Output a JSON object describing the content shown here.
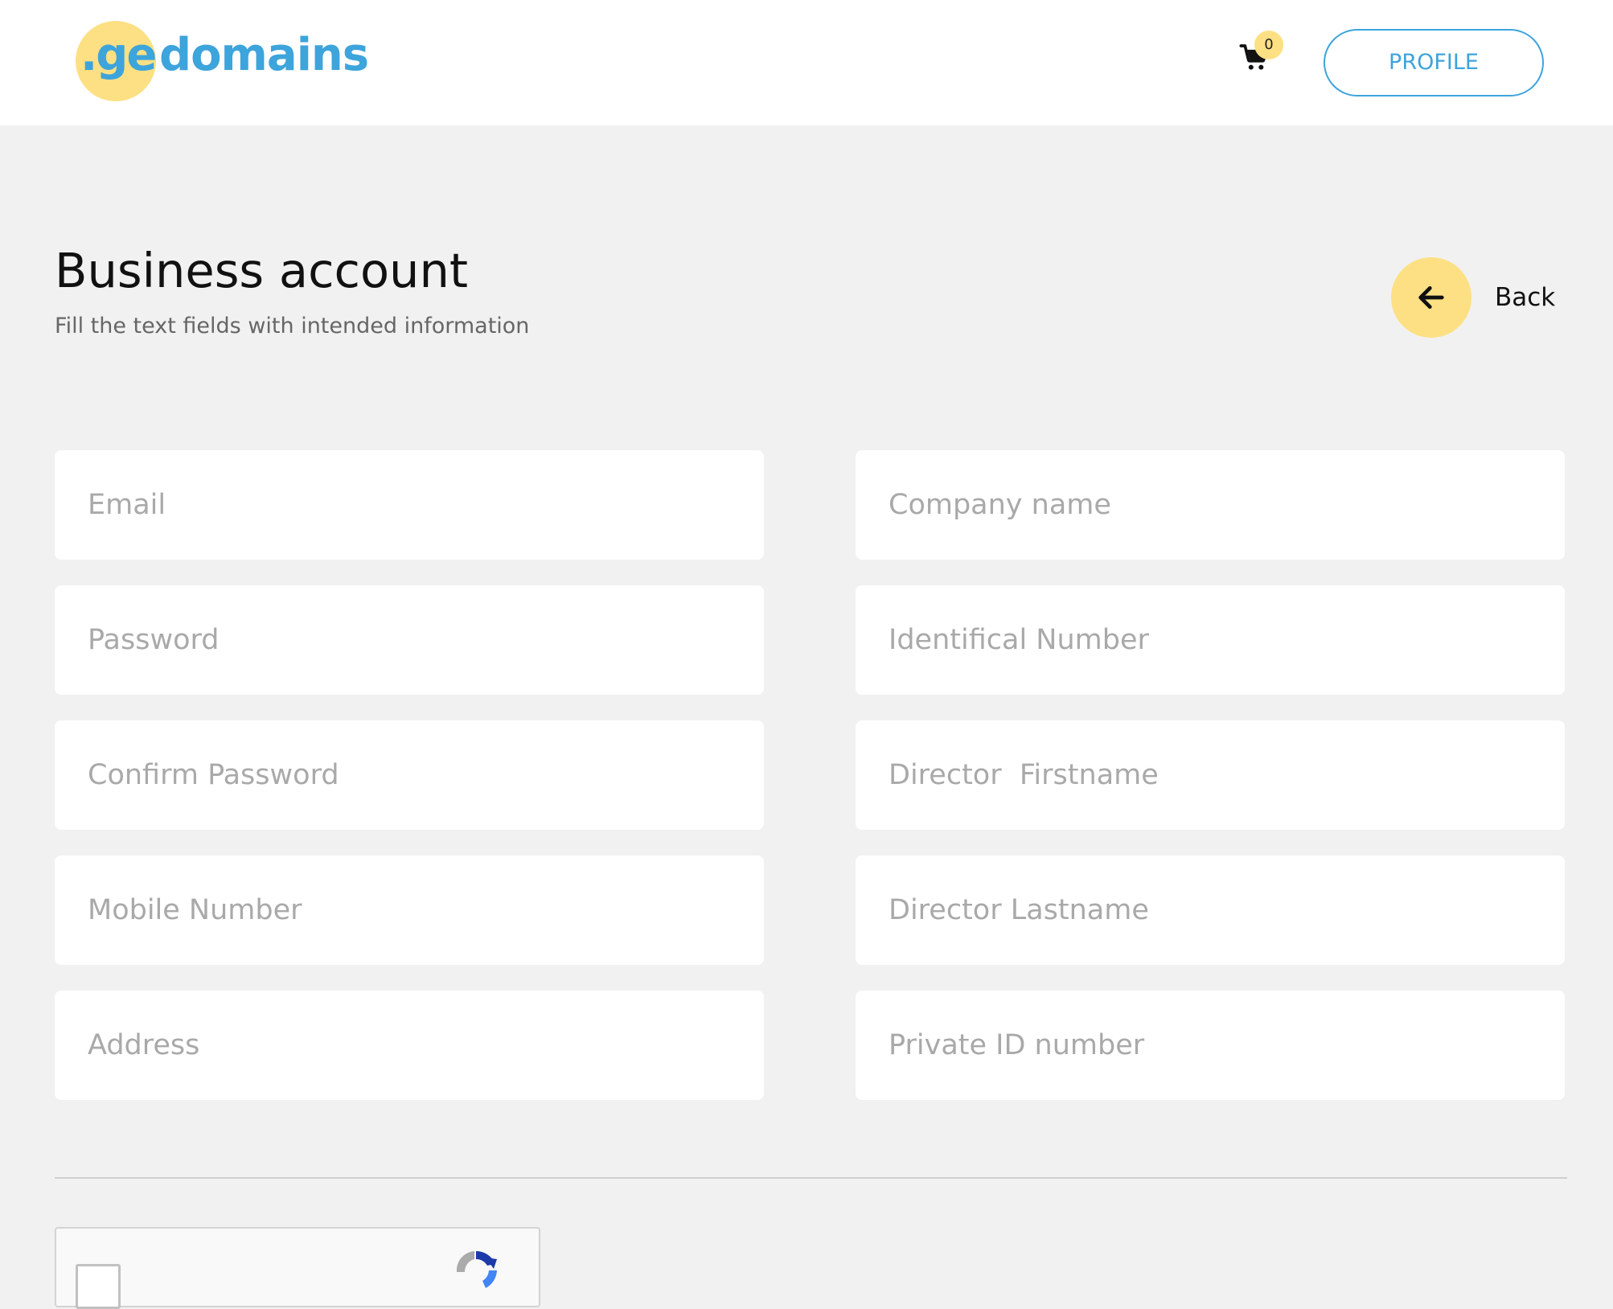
{
  "header": {
    "logo_prefix": ".ge",
    "logo_name": "domains",
    "cart_count": "0",
    "profile_label": "PROFILE"
  },
  "page": {
    "title": "Business account",
    "subtitle": "Fill the text fields with intended information",
    "back_label": "Back"
  },
  "form": {
    "left": [
      {
        "placeholder": "Email",
        "value": ""
      },
      {
        "placeholder": "Password",
        "value": ""
      },
      {
        "placeholder": "Confirm Password",
        "value": ""
      },
      {
        "placeholder": "Mobile Number",
        "value": ""
      },
      {
        "placeholder": "Address",
        "value": ""
      }
    ],
    "right": [
      {
        "placeholder": "Company name",
        "value": ""
      },
      {
        "placeholder": "Identifical Number",
        "value": ""
      },
      {
        "placeholder": "Director  Firstname",
        "value": ""
      },
      {
        "placeholder": "Director Lastname",
        "value": ""
      },
      {
        "placeholder": "Private ID number",
        "value": ""
      }
    ]
  },
  "icons": {
    "cart": "cart-icon",
    "back": "arrow-left-icon",
    "captcha": "recaptcha-icon"
  },
  "colors": {
    "accent_blue": "#3da4dc",
    "accent_yellow": "#fde083",
    "background": "#f1f1f1"
  }
}
